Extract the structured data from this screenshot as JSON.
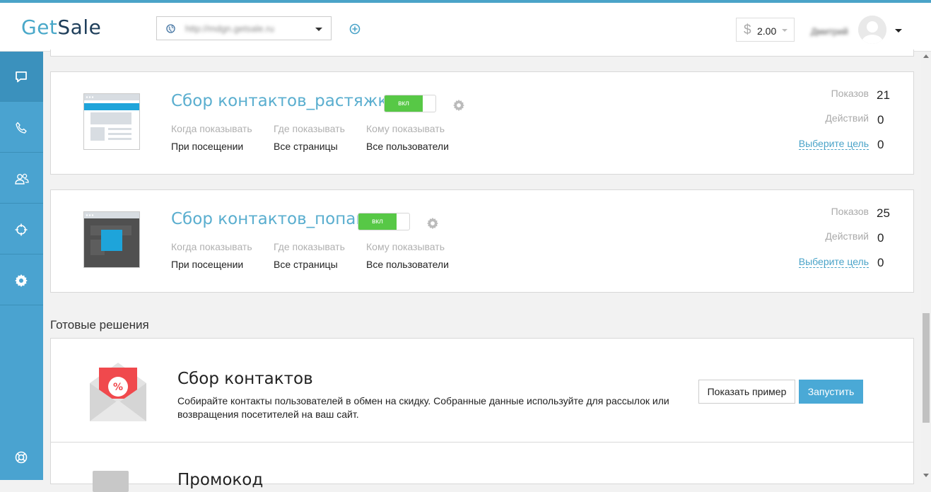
{
  "header": {
    "logo_get": "Get",
    "logo_sale": "Sale",
    "site_url": "http://mdgn.getsale.ru",
    "balance": "2.00",
    "balance_currency": "$",
    "username": "Дмитрий"
  },
  "sidebar": {
    "items": [
      {
        "icon": "chat-icon",
        "active": true
      },
      {
        "icon": "phone-icon",
        "active": false
      },
      {
        "icon": "users-icon",
        "active": false
      },
      {
        "icon": "target-icon",
        "active": false
      },
      {
        "icon": "gear-icon",
        "active": false
      }
    ],
    "help_icon": "lifebuoy-icon"
  },
  "widgets": [
    {
      "title": "Сбор контактов_растяжка",
      "toggle_label": "вкл",
      "when_label": "Когда показывать",
      "where_label": "Где показывать",
      "whom_label": "Кому показывать",
      "when": "При посещении",
      "where": "Все страницы",
      "whom": "Все пользователи",
      "shows_label": "Показов",
      "shows": "21",
      "actions_label": "Действий",
      "actions": "0",
      "goal_label": "Выберите цель",
      "goal": "0"
    },
    {
      "title": "Сбор контактов_попап",
      "toggle_label": "вкл",
      "when_label": "Когда показывать",
      "where_label": "Где показывать",
      "whom_label": "Кому показывать",
      "when": "При посещении",
      "where": "Все страницы",
      "whom": "Все пользователи",
      "shows_label": "Показов",
      "shows": "25",
      "actions_label": "Действий",
      "actions": "0",
      "goal_label": "Выберите цель",
      "goal": "0"
    }
  ],
  "ready": {
    "section_title": "Готовые решения",
    "items": [
      {
        "title": "Сбор контактов",
        "description": "Собирайте контакты пользователей в обмен на скидку. Собранные данные используйте для рассылок или возвращения посетителей на ваш сайт.",
        "example_button": "Показать пример",
        "run_button": "Запустить"
      },
      {
        "title": "Промокод"
      }
    ]
  },
  "colors": {
    "accent": "#4aa3c8",
    "sidebar": "#4aa3d0",
    "toggle_on": "#57c846",
    "run_button": "#4aa9d6"
  }
}
